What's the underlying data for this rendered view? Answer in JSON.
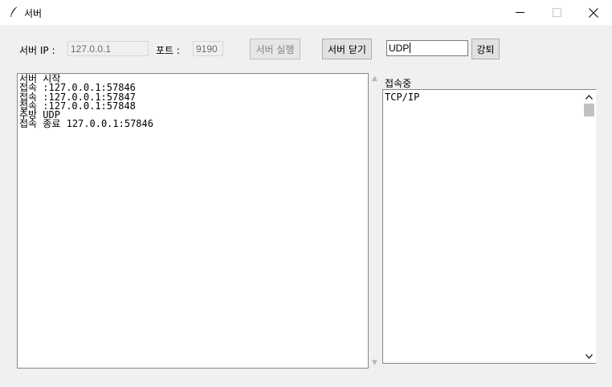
{
  "window": {
    "title": "서버",
    "icon": "feather-icon"
  },
  "toolbar": {
    "ip_label": "서버 IP :",
    "ip_value": "127.0.0.1",
    "port_label": "포트 :",
    "port_value": "9190",
    "start_button": "서버 실행",
    "close_button": "서버 닫기",
    "kick_input_value": "UDP",
    "kick_button": "강퇴"
  },
  "log": {
    "lines": [
      "서버 시작",
      "접속 :127.0.0.1:57846",
      "접속 :127.0.0.1:57847",
      "접속 :127.0.0.1:57848",
      "추방 UDP",
      "접속 종료 127.0.0.1:57846"
    ]
  },
  "connected": {
    "label": "접속중",
    "items": [
      "TCP/IP"
    ]
  }
}
